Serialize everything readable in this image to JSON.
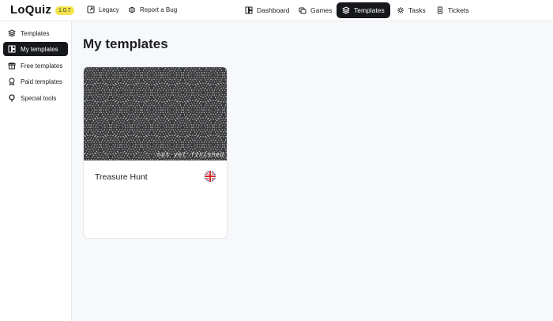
{
  "app": {
    "name": "LoQuiz",
    "version": "1.0.7"
  },
  "topbar": {
    "legacy_label": "Legacy",
    "report_bug_label": "Report a Bug",
    "nav": [
      {
        "label": "Dashboard",
        "icon": "dashboard-icon",
        "active": false
      },
      {
        "label": "Games",
        "icon": "games-icon",
        "active": false
      },
      {
        "label": "Templates",
        "icon": "layers-icon",
        "active": true
      },
      {
        "label": "Tasks",
        "icon": "tasks-icon",
        "active": false
      },
      {
        "label": "Tickets",
        "icon": "tickets-icon",
        "active": false
      }
    ]
  },
  "sidebar": {
    "items": [
      {
        "label": "Templates",
        "icon": "layers-icon",
        "active": false
      },
      {
        "label": "My templates",
        "icon": "grid-icon",
        "active": true
      },
      {
        "label": "Free templates",
        "icon": "gift-icon",
        "active": false
      },
      {
        "label": "Paid templates",
        "icon": "badge-icon",
        "active": false
      },
      {
        "label": "Special tools",
        "icon": "map-pin-icon",
        "active": false
      }
    ]
  },
  "main": {
    "title": "My templates",
    "templates": [
      {
        "title": "Treasure Hunt",
        "status_ribbon": "not yet finished",
        "language_flag": "uk-flag-icon"
      }
    ]
  },
  "colors": {
    "active_bg": "#16181b",
    "version_badge": "#f3e34a",
    "card_image_bg": "#3a3b3d"
  }
}
